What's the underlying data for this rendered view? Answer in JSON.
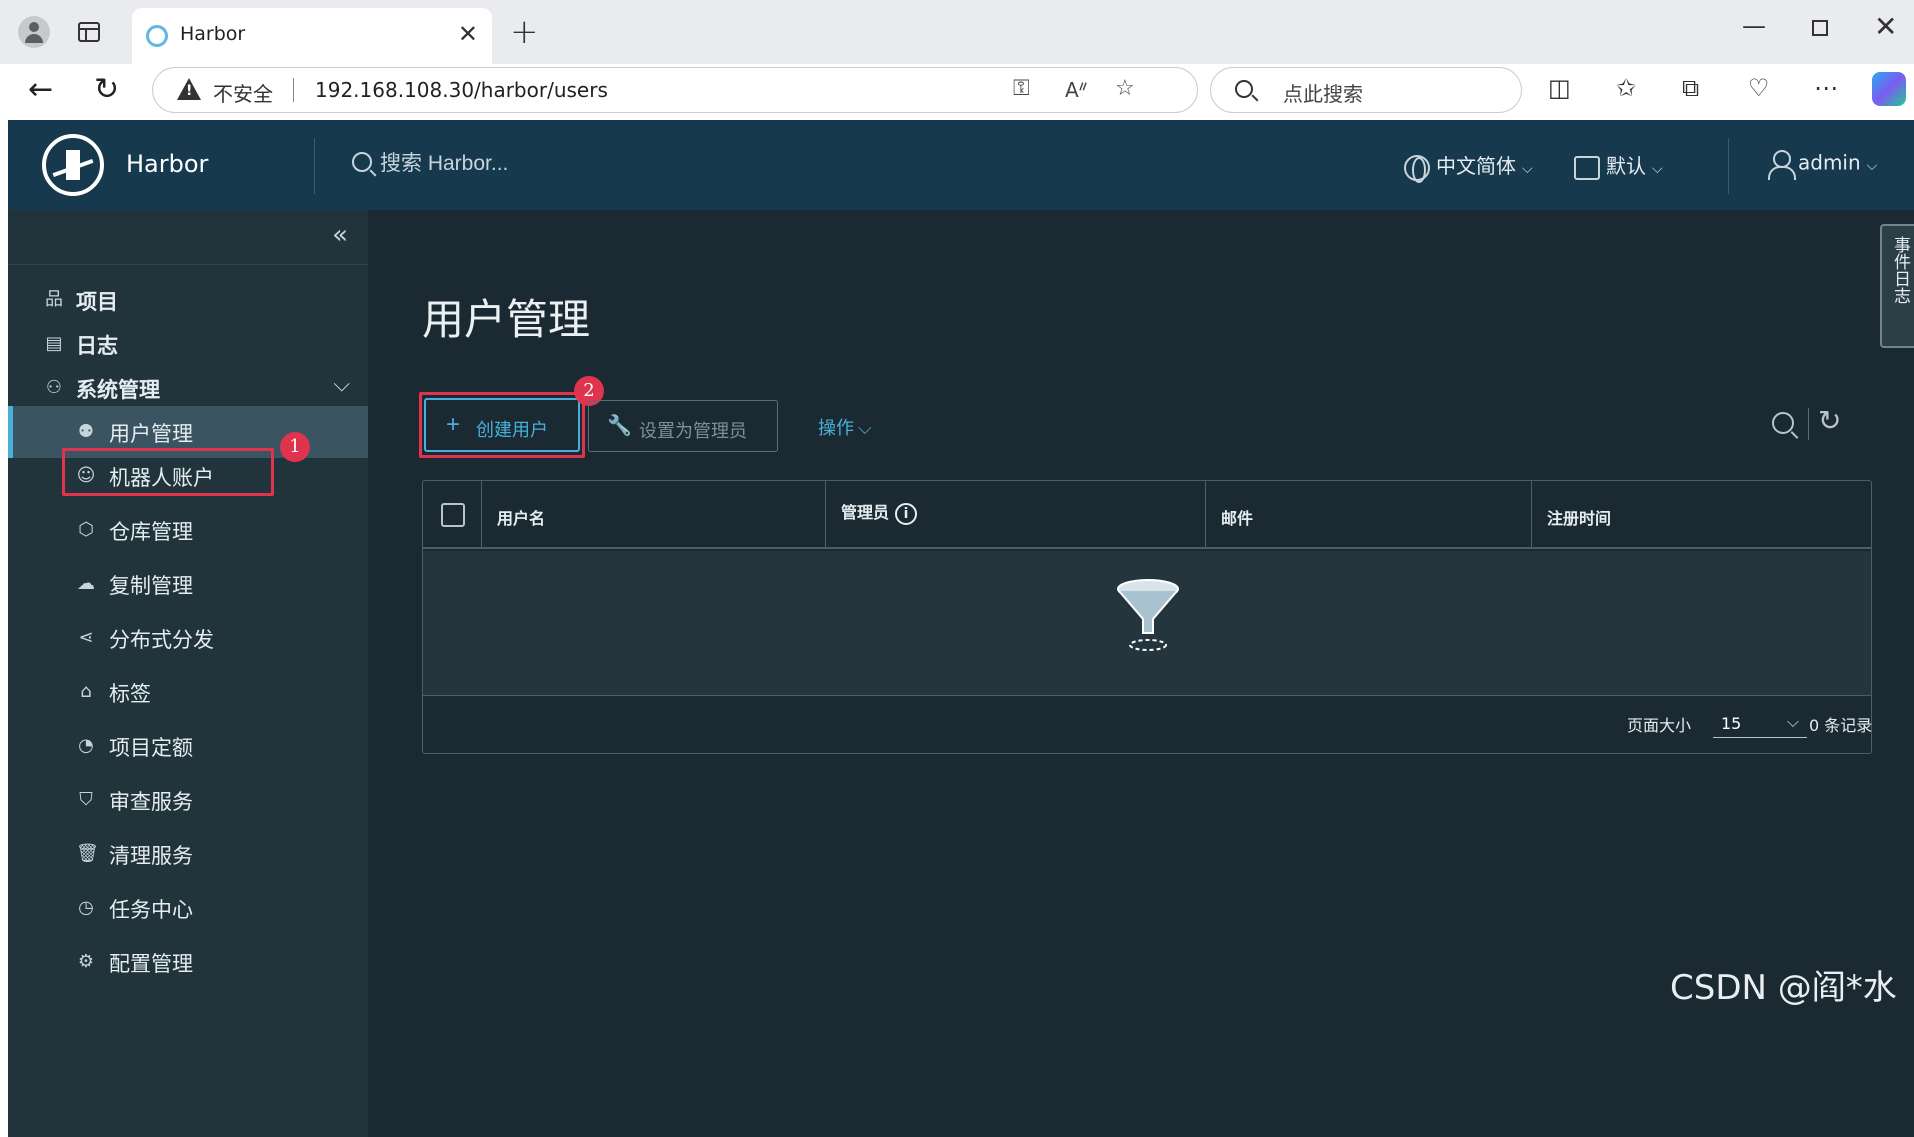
{
  "browser": {
    "tab_title": "Harbor",
    "insecure_label": "不安全",
    "url": "192.168.108.30/harbor/users",
    "search_placeholder": "点此搜索"
  },
  "header": {
    "brand": "Harbor",
    "search_placeholder": "搜索 Harbor...",
    "language": "中文简体",
    "date_format": "默认",
    "user": "admin"
  },
  "sidebar": {
    "top_items": [
      {
        "label": "项目",
        "icon": "projects-icon"
      },
      {
        "label": "日志",
        "icon": "logs-icon"
      },
      {
        "label": "系统管理",
        "icon": "admin-icon"
      }
    ],
    "sub_items": [
      {
        "label": "用户管理",
        "icon": "users-icon",
        "active": true
      },
      {
        "label": "机器人账户",
        "icon": "robot-icon"
      },
      {
        "label": "仓库管理",
        "icon": "registry-icon"
      },
      {
        "label": "复制管理",
        "icon": "replication-icon"
      },
      {
        "label": "分布式分发",
        "icon": "distribution-icon"
      },
      {
        "label": "标签",
        "icon": "tag-icon"
      },
      {
        "label": "项目定额",
        "icon": "quota-icon"
      },
      {
        "label": "审查服务",
        "icon": "shield-icon"
      },
      {
        "label": "清理服务",
        "icon": "trash-icon"
      },
      {
        "label": "任务中心",
        "icon": "dashboard-icon"
      },
      {
        "label": "配置管理",
        "icon": "gear-icon"
      }
    ]
  },
  "annotations": {
    "badge1": "1",
    "badge2": "2"
  },
  "main": {
    "title": "用户管理",
    "event_log": "事件日志",
    "actions": {
      "create_user": "创建用户",
      "set_admin": "设置为管理员",
      "operations": "操作"
    },
    "table": {
      "columns": [
        "用户名",
        "管理员",
        "邮件",
        "注册时间"
      ],
      "page_size_label": "页面大小",
      "page_size": "15",
      "records": "0 条记录"
    }
  },
  "watermark": "CSDN @阎*水",
  "colors": {
    "header_bg": "#17394e",
    "sidebar_bg": "#21333b",
    "content_bg": "#1b2a32",
    "accent": "#49afd9",
    "annotation_red": "#e0344e"
  }
}
